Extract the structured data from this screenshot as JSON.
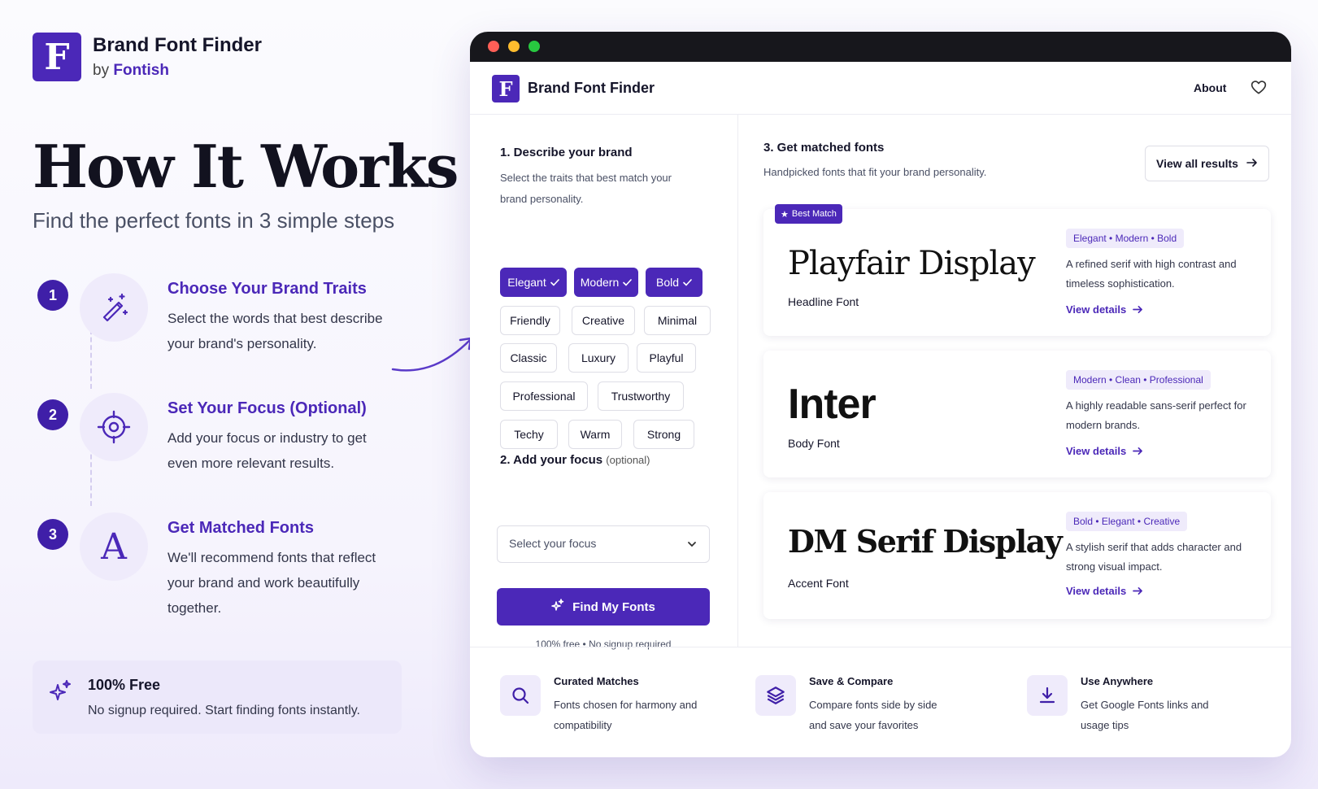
{
  "left": {
    "brand": {
      "logo_letter": "F",
      "name": "Brand Font Finder",
      "by": "by",
      "by_brand": "Fontish"
    },
    "hero_title": "How It Works",
    "hero_subtitle": "Find the perfect fonts in 3 simple steps",
    "steps": [
      {
        "number": "1",
        "icon": "magic-wand-icon",
        "title": "Choose Your Brand Traits",
        "desc": "Select the words that best describe your brand's personality."
      },
      {
        "number": "2",
        "icon": "target-icon",
        "title": "Set Your Focus (Optional)",
        "desc": "Add your focus or industry to get even more relevant results."
      },
      {
        "number": "3",
        "icon": "letter-a-icon",
        "glyph": "A",
        "title": "Get Matched Fonts",
        "desc": "We'll recommend fonts that reflect your brand and work beautifully together."
      }
    ],
    "free_box": {
      "title": "100% Free",
      "subtitle": "No signup required. Start finding fonts instantly."
    }
  },
  "app": {
    "logo_letter": "F",
    "title": "Brand Font Finder",
    "nav_about": "About",
    "section1": {
      "title": "1. Describe your brand",
      "subtitle": "Select the traits that best match your brand personality."
    },
    "traits": [
      {
        "label": "Elegant",
        "selected": true
      },
      {
        "label": "Modern",
        "selected": true
      },
      {
        "label": "Bold",
        "selected": true
      },
      {
        "label": "Friendly",
        "selected": false
      },
      {
        "label": "Creative",
        "selected": false
      },
      {
        "label": "Minimal",
        "selected": false
      },
      {
        "label": "Classic",
        "selected": false
      },
      {
        "label": "Luxury",
        "selected": false
      },
      {
        "label": "Playful",
        "selected": false
      },
      {
        "label": "Professional",
        "selected": false
      },
      {
        "label": "Trustworthy",
        "selected": false
      },
      {
        "label": "Techy",
        "selected": false
      },
      {
        "label": "Warm",
        "selected": false
      },
      {
        "label": "Strong",
        "selected": false
      }
    ],
    "section2": {
      "title": "2. Add your focus",
      "optional": "(optional)",
      "select_placeholder": "Select your focus"
    },
    "find_button": "Find My Fonts",
    "find_note": "100% free • No signup required",
    "section3": {
      "title": "3. Get matched fonts",
      "subtitle": "Handpicked fonts that fit your brand personality.",
      "view_all": "View all results"
    },
    "results": [
      {
        "badge": "Best Match",
        "font": "Playfair Display",
        "role": "Headline Font",
        "tags": "Elegant • Modern • Bold",
        "desc": "A refined serif with high contrast and timeless sophistication.",
        "link": "View details"
      },
      {
        "font": "Inter",
        "role": "Body Font",
        "tags": "Modern • Clean • Professional",
        "desc": "A highly readable sans-serif perfect for modern brands.",
        "link": "View details"
      },
      {
        "font": "DM Serif Display",
        "role": "Accent Font",
        "tags": "Bold • Elegant • Creative",
        "desc": "A stylish serif that adds character and strong visual impact.",
        "link": "View details"
      }
    ],
    "features": [
      {
        "icon": "search-icon",
        "title": "Curated Matches",
        "desc": "Fonts chosen for harmony and compatibility"
      },
      {
        "icon": "layers-icon",
        "title": "Save & Compare",
        "desc": "Compare fonts side by side and save your favorites"
      },
      {
        "icon": "download-icon",
        "title": "Use Anywhere",
        "desc": "Get Google Fonts links and usage tips"
      }
    ]
  },
  "colors": {
    "accent": "#4b28b8",
    "accent_light": "#efebfb",
    "text": "#15152a",
    "titlebar": "#17171c"
  }
}
